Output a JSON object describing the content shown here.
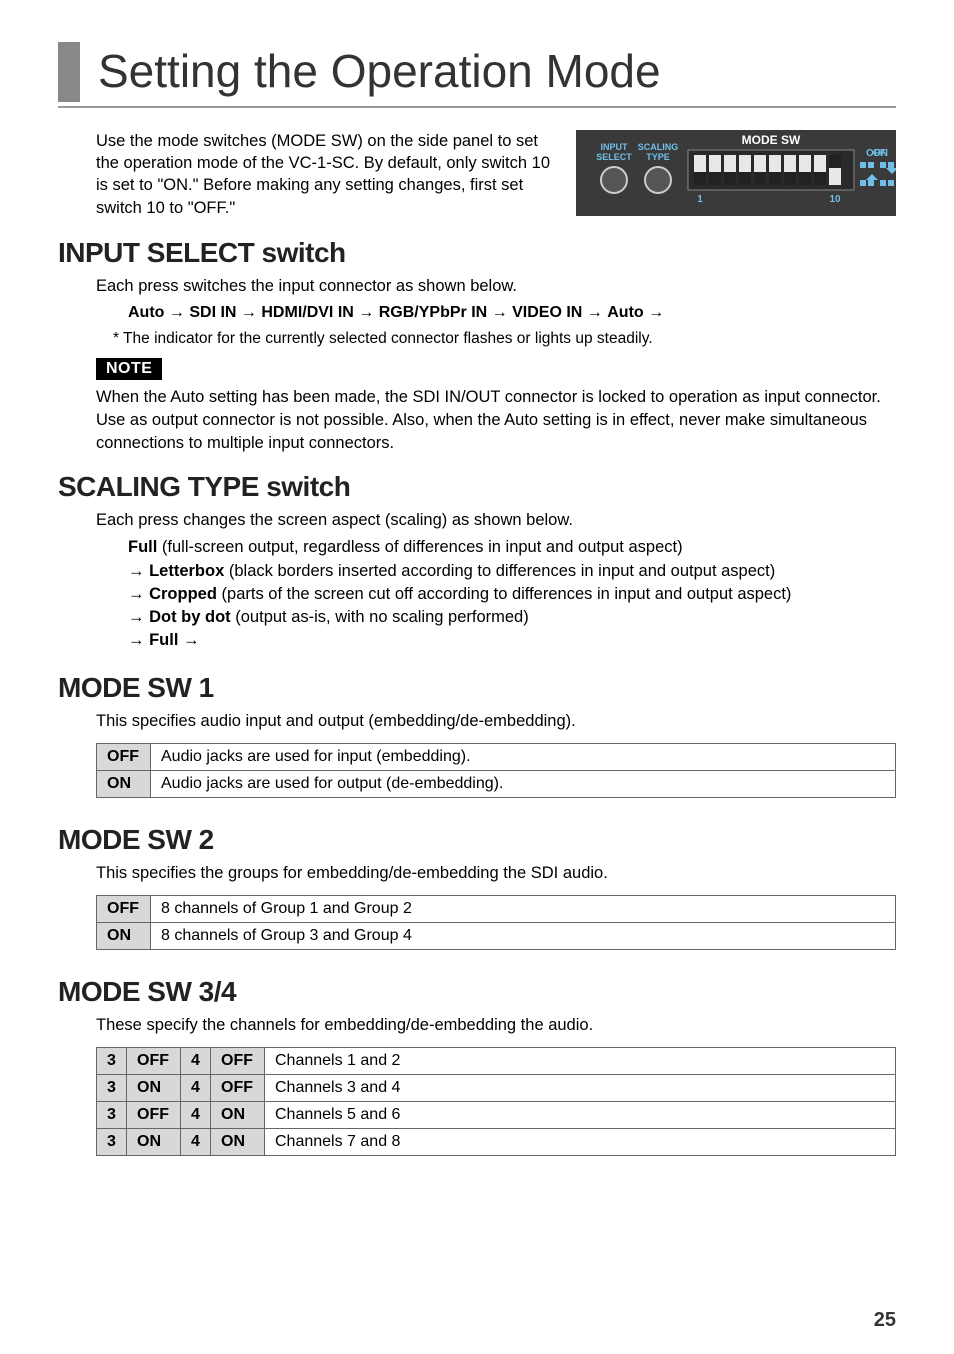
{
  "title": "Setting the Operation Mode",
  "intro": "Use the mode switches (MODE SW) on the side panel to set the operation mode of the VC-1-SC. By default, only switch 10 is set to \"ON.\" Before making any setting changes, first set switch 10 to \"OFF.\"",
  "panel": {
    "label_mode_sw": "MODE SW",
    "label_input_select": "INPUT",
    "label_input_select2": "SELECT",
    "label_scaling_type": "SCALING",
    "label_scaling_type2": "TYPE",
    "label_off": "OFF",
    "label_on": "ON",
    "tick_1": "1",
    "tick_10": "10"
  },
  "sections": {
    "input_select": {
      "heading": "INPUT SELECT switch",
      "body": "Each press switches the input connector as shown below.",
      "seq": [
        "Auto",
        "SDI IN",
        "HDMI/DVI IN",
        "RGB/YPbPr IN",
        "VIDEO IN",
        "Auto"
      ],
      "footnote": "* The indicator for the currently selected connector flashes or lights up steadily.",
      "note_label": "NOTE",
      "note": "When the Auto setting has been made, the SDI IN/OUT connector is locked to operation as input connector. Use as output connector is not possible. Also, when the Auto setting is in effect, never make simultaneous connections to multiple input connectors."
    },
    "scaling_type": {
      "heading": "SCALING TYPE switch",
      "body": "Each press changes the screen aspect (scaling) as shown below.",
      "items": [
        {
          "name": "Full",
          "desc": " (full-screen output, regardless of differences in input and output aspect)",
          "leading_arrow": false
        },
        {
          "name": "Letterbox",
          "desc": " (black borders inserted according to differences in input and output aspect)",
          "leading_arrow": true
        },
        {
          "name": "Cropped",
          "desc": " (parts of the screen cut off according to differences in input and output aspect)",
          "leading_arrow": true
        },
        {
          "name": "Dot by dot",
          "desc": " (output as-is, with no scaling performed)",
          "leading_arrow": true
        },
        {
          "name": "Full",
          "desc": "",
          "leading_arrow": true,
          "trailing_arrow": true
        }
      ]
    },
    "sw1": {
      "heading": "MODE SW 1",
      "body": "This specifies audio input and output (embedding/de-embedding).",
      "rows": [
        {
          "k": "OFF",
          "v": "Audio jacks are used for input (embedding)."
        },
        {
          "k": "ON",
          "v": "Audio jacks are used for output (de-embedding)."
        }
      ]
    },
    "sw2": {
      "heading": "MODE SW 2",
      "body": "This specifies the groups for embedding/de-embedding the SDI audio.",
      "rows": [
        {
          "k": "OFF",
          "v": "8 channels of Group 1 and Group 2"
        },
        {
          "k": "ON",
          "v": "8 channels of Group 3 and Group 4"
        }
      ]
    },
    "sw34": {
      "heading": "MODE SW 3/4",
      "body": "These specify the channels for embedding/de-embedding the audio.",
      "col_a": "3",
      "col_b": "4",
      "rows": [
        {
          "a": "OFF",
          "b": "OFF",
          "v": "Channels 1 and 2"
        },
        {
          "a": "ON",
          "b": "OFF",
          "v": "Channels 3 and 4"
        },
        {
          "a": "OFF",
          "b": "ON",
          "v": "Channels 5 and 6"
        },
        {
          "a": "ON",
          "b": "ON",
          "v": "Channels 7 and 8"
        }
      ]
    }
  },
  "page_number": "25"
}
